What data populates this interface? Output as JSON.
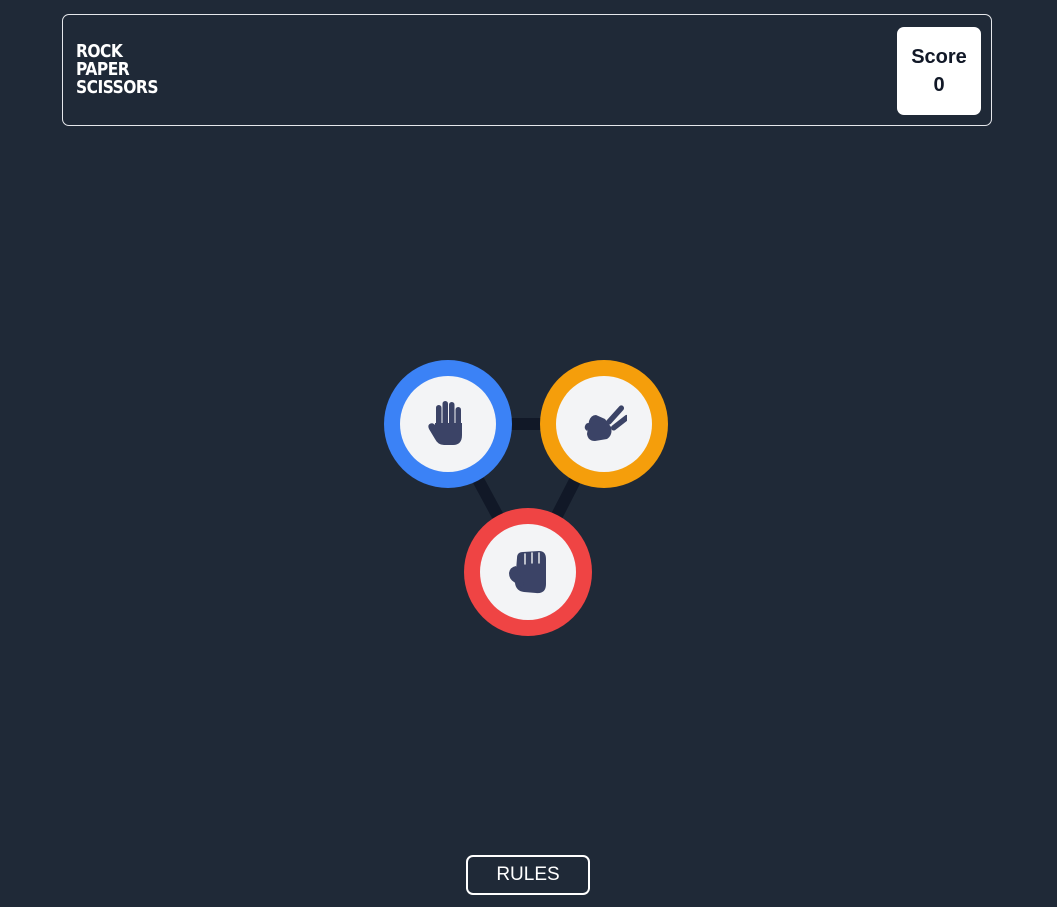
{
  "header": {
    "logo_lines": [
      "ROCK",
      "PAPER",
      "SCISSORS"
    ],
    "score_label": "Score",
    "score_value": "0"
  },
  "choices": [
    {
      "id": "paper",
      "icon": "paper-hand-icon",
      "ring_color": "#3b82f6"
    },
    {
      "id": "scissors",
      "icon": "scissors-hand-icon",
      "ring_color": "#f59e0b"
    },
    {
      "id": "rock",
      "icon": "rock-fist-icon",
      "ring_color": "#ef4444"
    }
  ],
  "colors": {
    "background": "#1f2937",
    "icon": "#3b4366",
    "connector": "#111827"
  },
  "rules_button_label": "RULES"
}
